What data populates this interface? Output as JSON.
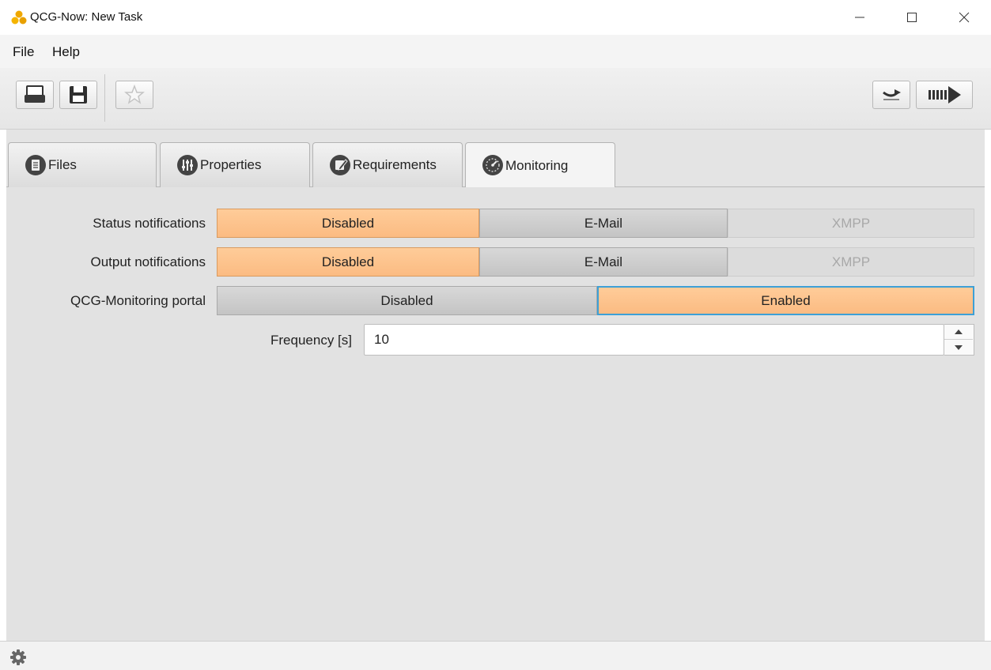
{
  "window": {
    "title": "QCG-Now: New Task",
    "app_icon": "honeycomb-cluster-icon",
    "controls": {
      "minimize": "minimize-icon",
      "maximize": "maximize-icon",
      "close": "close-icon"
    }
  },
  "menubar": {
    "items": [
      {
        "label": "File"
      },
      {
        "label": "Help"
      }
    ]
  },
  "toolbar": {
    "left_buttons": [
      {
        "icon": "print-icon"
      },
      {
        "icon": "save-icon"
      },
      {
        "icon": "star-icon"
      }
    ],
    "right_buttons": [
      {
        "icon": "submit-arrow-icon"
      },
      {
        "icon": "run-arrow-icon"
      }
    ]
  },
  "tabs": [
    {
      "label": "Files",
      "icon": "file-icon",
      "active": false
    },
    {
      "label": "Properties",
      "icon": "sliders-icon",
      "active": false
    },
    {
      "label": "Requirements",
      "icon": "edit-icon",
      "active": false
    },
    {
      "label": "Monitoring",
      "icon": "gauge-icon",
      "active": true
    }
  ],
  "monitoring": {
    "status_notifications": {
      "label": "Status notifications",
      "options": [
        "Disabled",
        "E-Mail",
        "XMPP"
      ],
      "selected": "Disabled"
    },
    "output_notifications": {
      "label": "Output notifications",
      "options": [
        "Disabled",
        "E-Mail",
        "XMPP"
      ],
      "selected": "Disabled"
    },
    "portal": {
      "label": "QCG-Monitoring portal",
      "options": [
        "Disabled",
        "Enabled"
      ],
      "selected": "Enabled"
    },
    "frequency": {
      "label": "Frequency [s]",
      "value": "10"
    }
  },
  "statusbar": {
    "icon": "gear-icon"
  },
  "colors": {
    "selected_segment": "#fbbb82",
    "unselected_segment": "#c8c8c8",
    "focus_border": "#3da0d6",
    "app_icon": "#f0a800"
  }
}
